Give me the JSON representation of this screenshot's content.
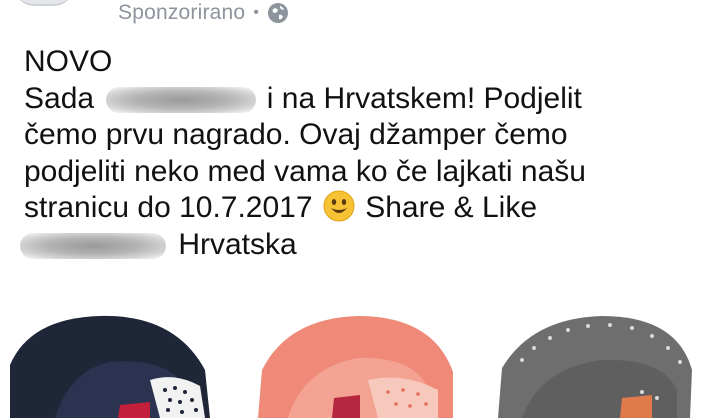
{
  "post": {
    "sponsored_label": "Sponzorirano",
    "separator": "•",
    "privacy_icon": "globe-icon",
    "line1": "NOVO",
    "line2_a": "Sada",
    "line2_b": "i na Hrvatskem! Podjelit",
    "line3": "čemo prvu nagrado. Ovaj džamper čemo",
    "line4": "podjeliti neko med vama ko če lajkati našu",
    "line5_a": "stranicu do 10.7.2017",
    "emoji": "smiley-emoji-icon",
    "line5_b": "Share & Like",
    "line6_b": "Hrvatska"
  },
  "products": [
    {
      "name": "navy hoodie with polka-dot lining",
      "color": "#1f2638",
      "accent": "#e8e8e8"
    },
    {
      "name": "coral hoodie with dotted lining",
      "color": "#f08a78",
      "accent": "#f7c9bd"
    },
    {
      "name": "grey hoodie with dotted trim",
      "color": "#6e6e6e",
      "accent": "#d9d9d9"
    }
  ]
}
